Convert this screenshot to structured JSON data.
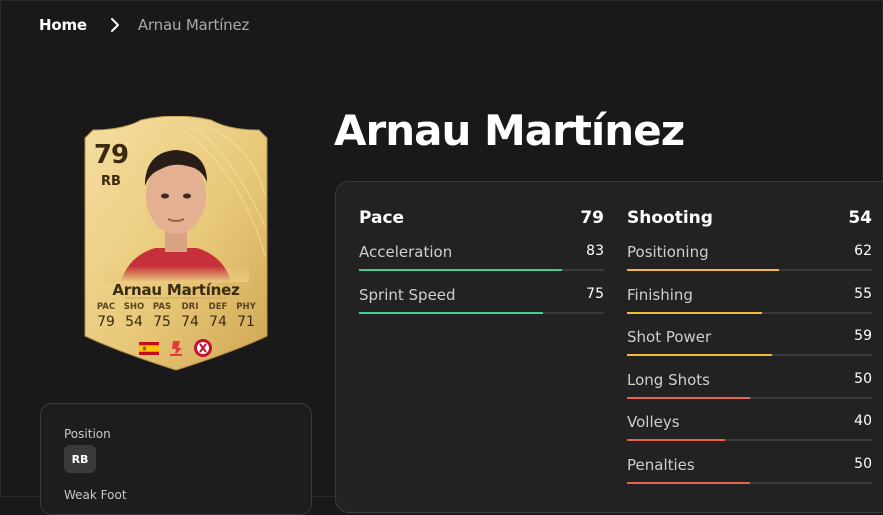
{
  "breadcrumb": {
    "home": "Home",
    "current": "Arnau Martínez"
  },
  "player": {
    "name": "Arnau Martínez",
    "card": {
      "rating": "79",
      "position": "RB",
      "name": "Arnau Martínez",
      "stats": [
        {
          "label": "PAC",
          "value": "79"
        },
        {
          "label": "SHO",
          "value": "54"
        },
        {
          "label": "PAS",
          "value": "75"
        },
        {
          "label": "DRI",
          "value": "74"
        },
        {
          "label": "DEF",
          "value": "74"
        },
        {
          "label": "PHY",
          "value": "71"
        }
      ],
      "badges": [
        "spain-flag-icon",
        "laliga-logo-icon",
        "girona-crest-icon"
      ]
    }
  },
  "info": {
    "position_label": "Position",
    "position_value": "RB",
    "weak_foot_label": "Weak Foot"
  },
  "colors": {
    "green": "#3fcf8e",
    "yellow": "#f2b93b",
    "red": "#e8644f",
    "card_gold": "#e7c877"
  },
  "stats": {
    "pace": {
      "title": "Pace",
      "value": "79",
      "items": [
        {
          "name": "Acceleration",
          "value": "83",
          "level": 0.83,
          "color": "#3fcf8e"
        },
        {
          "name": "Sprint Speed",
          "value": "75",
          "level": 0.75,
          "color": "#3fcf8e"
        }
      ]
    },
    "shooting": {
      "title": "Shooting",
      "value": "54",
      "items": [
        {
          "name": "Positioning",
          "value": "62",
          "level": 0.62,
          "color": "#f2b93b"
        },
        {
          "name": "Finishing",
          "value": "55",
          "level": 0.55,
          "color": "#f2b93b"
        },
        {
          "name": "Shot Power",
          "value": "59",
          "level": 0.59,
          "color": "#f2b93b"
        },
        {
          "name": "Long Shots",
          "value": "50",
          "level": 0.5,
          "color": "#e8644f"
        },
        {
          "name": "Volleys",
          "value": "40",
          "level": 0.4,
          "color": "#e8644f"
        },
        {
          "name": "Penalties",
          "value": "50",
          "level": 0.5,
          "color": "#e8644f"
        }
      ]
    }
  }
}
